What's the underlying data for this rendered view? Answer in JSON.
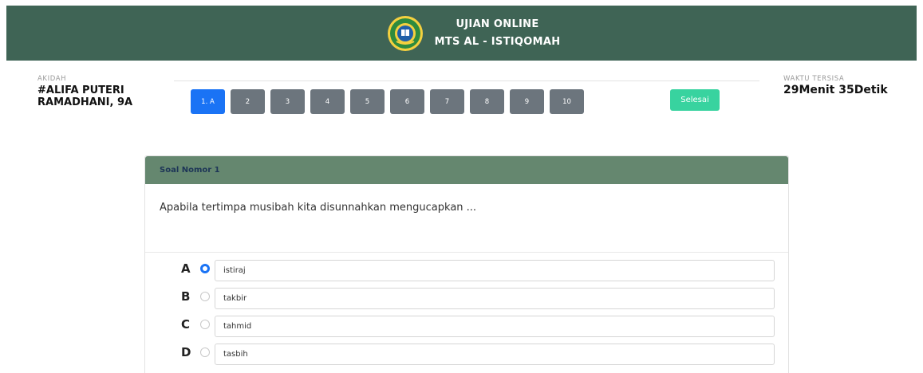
{
  "header": {
    "title_line1": "UJIAN ONLINE",
    "title_line2": "MTS AL - ISTIQOMAH",
    "logo_icon": "school-emblem-icon"
  },
  "student": {
    "subject": "AKIDAH",
    "name": "#ALIFA PUTERI RAMADHANI, 9A"
  },
  "timer": {
    "label": "WAKTU TERSISA",
    "value": "29Menit 35Detik"
  },
  "navigation": {
    "buttons": [
      "1. A",
      "2",
      "3",
      "4",
      "5",
      "6",
      "7",
      "8",
      "9",
      "10"
    ],
    "active_index": 0,
    "finish_label": "Selesai"
  },
  "question": {
    "header": "Soal Nomor 1",
    "text": "Apabila tertimpa musibah kita disunnahkan mengucapkan ...",
    "selected": "A",
    "options": [
      {
        "letter": "A",
        "text": "istiraj"
      },
      {
        "letter": "B",
        "text": "takbir"
      },
      {
        "letter": "C",
        "text": "tahmid"
      },
      {
        "letter": "D",
        "text": "tasbih"
      }
    ]
  },
  "colors": {
    "header_bg": "#3f6455",
    "card_header_bg": "#65876f",
    "active_button": "#1a73f5",
    "inactive_button": "#6c757d",
    "finish_button": "#38d39f"
  }
}
